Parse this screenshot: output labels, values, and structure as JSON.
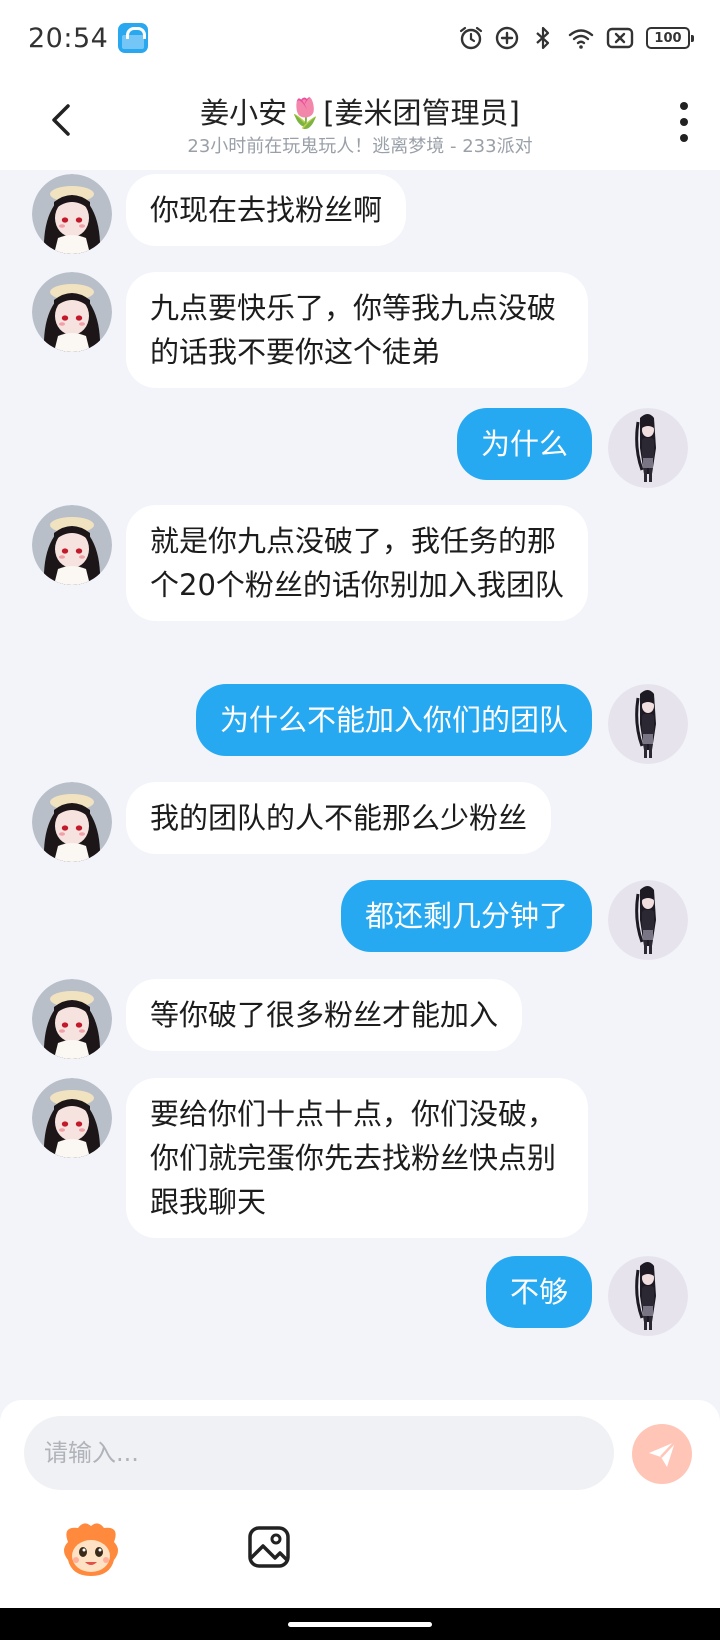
{
  "status_bar": {
    "time": "20:54",
    "notification_icon": "app-bag-icon",
    "icons": [
      "alarm-icon",
      "data-saver-icon",
      "bluetooth-icon",
      "wifi-icon",
      "sim-off-icon"
    ],
    "battery": "100"
  },
  "header": {
    "title": "姜小安🌷[姜米团管理员]",
    "subtitle": "23小时前在玩鬼玩人！逃离梦境 - 233派对"
  },
  "messages": [
    {
      "side": "left",
      "text": "你现在去找粉丝啊"
    },
    {
      "side": "left",
      "text": "九点要快乐了，你等我九点没破的话我不要你这个徒弟"
    },
    {
      "side": "right",
      "text": "为什么"
    },
    {
      "side": "left",
      "text": "就是你九点没破了，我任务的那个20个粉丝的话你别加入我团队"
    },
    {
      "side": "right",
      "text": "为什么不能加入你们的团队"
    },
    {
      "side": "left",
      "text": "我的团队的人不能那么少粉丝"
    },
    {
      "side": "right",
      "text": "都还剩几分钟了"
    },
    {
      "side": "left",
      "text": "等你破了很多粉丝才能加入"
    },
    {
      "side": "left",
      "text": "要给你们十点十点，你们没破，你们就完蛋你先去找粉丝快点别跟我聊天"
    },
    {
      "side": "right",
      "text": "不够"
    }
  ],
  "input": {
    "placeholder": "请输入...",
    "value": ""
  },
  "toolbar": {
    "send_icon": "send-icon",
    "emoji_icon": "emoji-mascot-icon",
    "image_icon": "image-icon"
  },
  "colors": {
    "outgoing_bubble": "#27a9f1",
    "incoming_bubble": "#ffffff",
    "chat_background": "#f2f4fa",
    "send_button": "#ffc6b8"
  }
}
